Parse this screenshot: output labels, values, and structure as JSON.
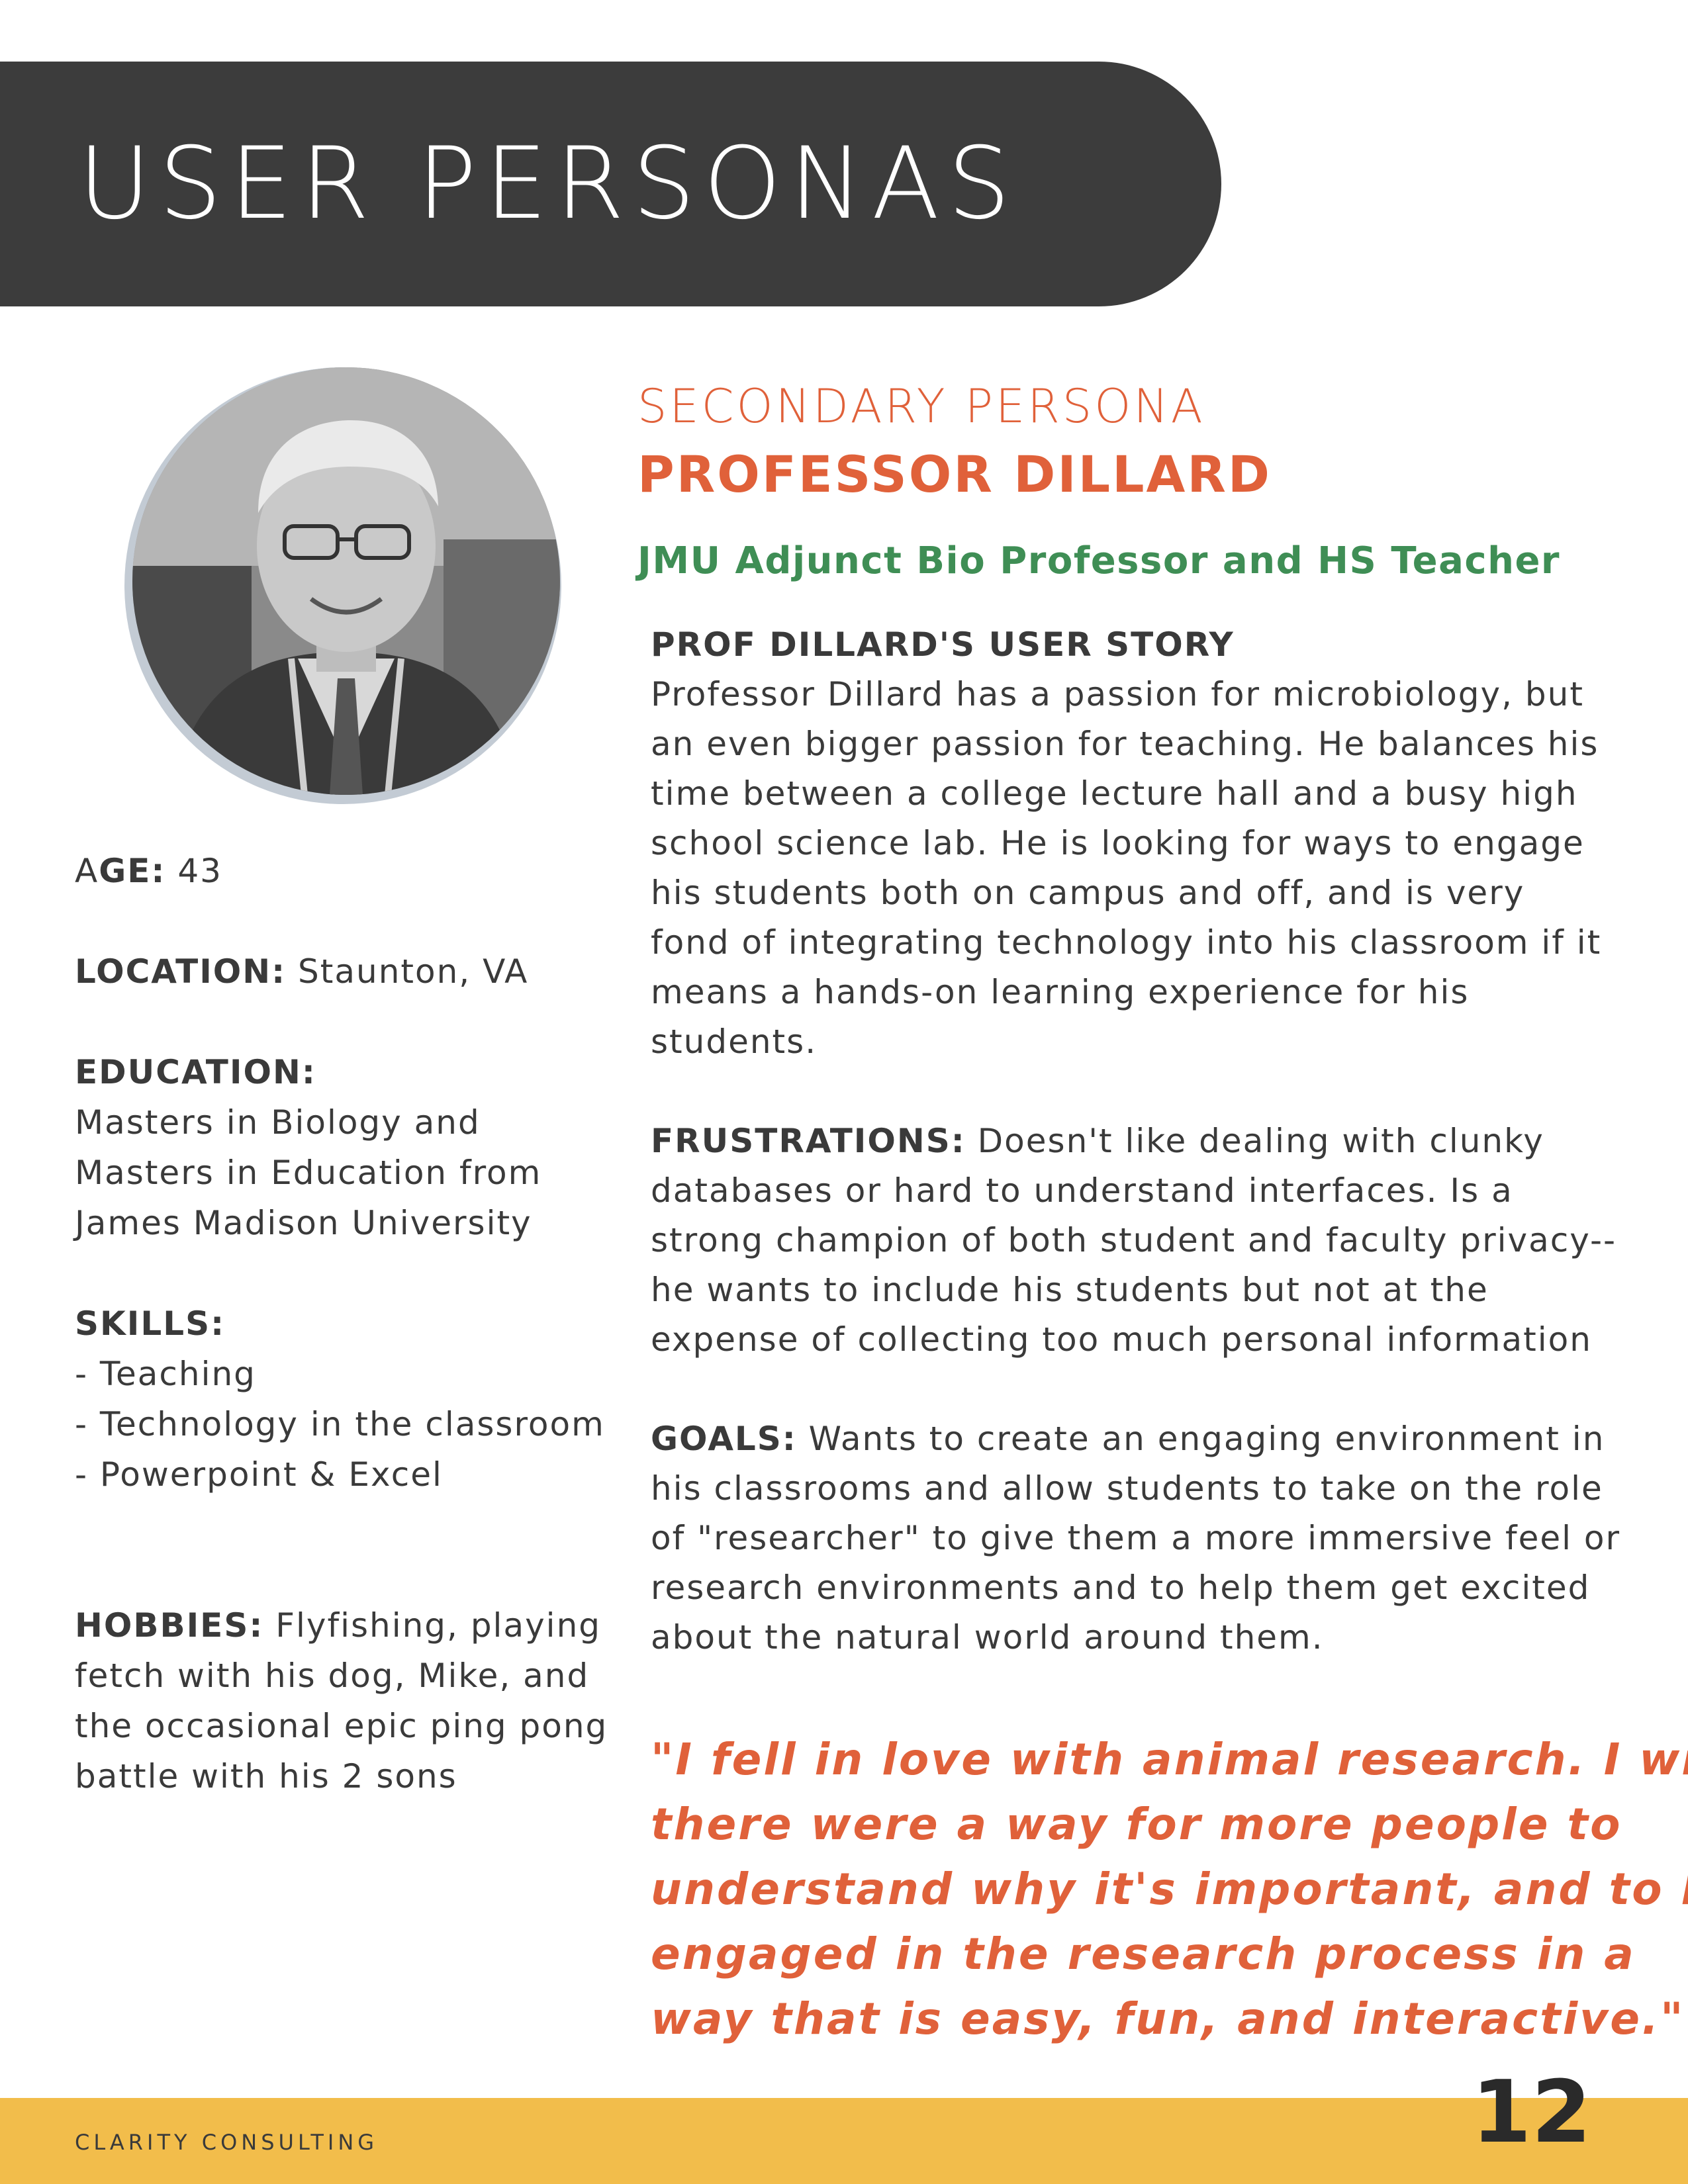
{
  "header": {
    "title": "USER PERSONAS"
  },
  "persona": {
    "type_label": "SECONDARY PERSONA",
    "name": "PROFESSOR DILLARD",
    "role": "JMU Adjunct Bio Professor and HS Teacher",
    "photo_alt": "portrait-photo"
  },
  "profile": {
    "age_label_a": "A",
    "age_label_rest": "GE:",
    "age_value": " 43",
    "location_label": "LOCATION:",
    "location_value": " Staunton, VA",
    "education_label": "EDUCATION:",
    "education_lines": [
      "Masters in Biology and",
      "Masters in Education from",
      "James Madison University"
    ],
    "skills_label": "SKILLS:",
    "skills": [
      "- Teaching",
      "- Technology in the classroom",
      "- Powerpoint & Excel"
    ],
    "hobbies_label": "HOBBIES:",
    "hobbies_lines": [
      " Flyfishing, playing",
      "fetch with his dog, Mike, and",
      "the occasional epic ping pong",
      "battle with his 2 sons"
    ]
  },
  "story": {
    "heading": "PROF DILLARD'S USER STORY",
    "lines": [
      "Professor Dillard has a passion for microbiology, but",
      "an even bigger passion for teaching. He balances his",
      "time between a college lecture hall and a busy high",
      "school science lab. He is looking for ways to engage",
      "his students both on campus and off, and is very",
      "fond of integrating technology into his classroom if it",
      "means a hands-on learning experience for his",
      "students."
    ]
  },
  "frustrations": {
    "label": "FRUSTRATIONS:",
    "lines": [
      " Doesn't like dealing with clunky",
      "databases or hard to understand interfaces. Is a",
      "strong champion of both student and faculty privacy--",
      "he wants to include his students but not at the",
      "expense of collecting too much personal information"
    ]
  },
  "goals": {
    "label": "GOALS:",
    "lines": [
      " Wants to create an engaging environment in",
      "his classrooms and allow students to take on the role",
      "of \"researcher\" to give them a more immersive feel or",
      "research environments and to help them get excited",
      "about the natural world around them."
    ]
  },
  "quote": {
    "lines": [
      "\"I fell in love with animal research. I wish",
      "there were a way for more people to",
      "understand why it's important, and to be",
      "engaged in the research process in a",
      "way that is easy, fun, and interactive.\""
    ]
  },
  "footer": {
    "brand": "CLARITY CONSULTING",
    "page_number": "12"
  },
  "colors": {
    "accent": "#e0613a",
    "role_green": "#3f8e55",
    "banner": "#3c3c3c",
    "footer": "#f2bd4b"
  }
}
